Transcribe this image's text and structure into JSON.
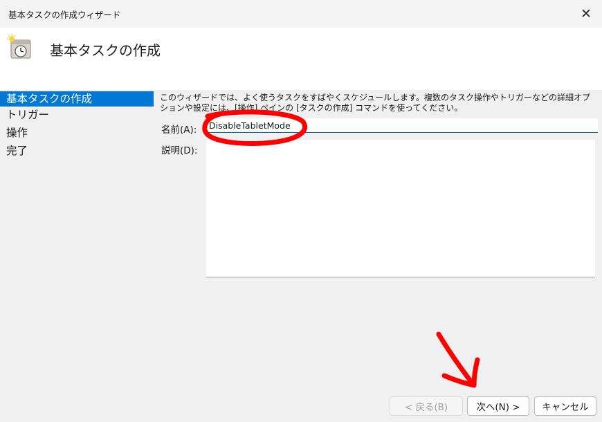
{
  "window": {
    "title": "基本タスクの作成ウィザード",
    "close_glyph": "✕"
  },
  "header": {
    "title": "基本タスクの作成",
    "icon": "task-scheduler-clock-icon"
  },
  "sidebar": {
    "items": [
      {
        "label": "基本タスクの作成",
        "active": true
      },
      {
        "label": "トリガー"
      },
      {
        "label": "操作"
      },
      {
        "label": "完了"
      }
    ]
  },
  "content": {
    "intro": "このウィザードでは、よく使うタスクをすばやくスケジュールします。複数のタスク操作やトリガーなどの詳細オプションや設定には、[操作] ペインの [タスクの作成] コマンドを使ってください。",
    "name_label": "名前(A):",
    "name_value": "DisableTabletMode",
    "description_label": "説明(D):",
    "description_value": ""
  },
  "buttons": {
    "back": "< 戻る(B)",
    "next": "次へ(N) >",
    "cancel": "キャンセル"
  },
  "colors": {
    "accent": "#0078d4",
    "annotation": "#ff0000"
  }
}
